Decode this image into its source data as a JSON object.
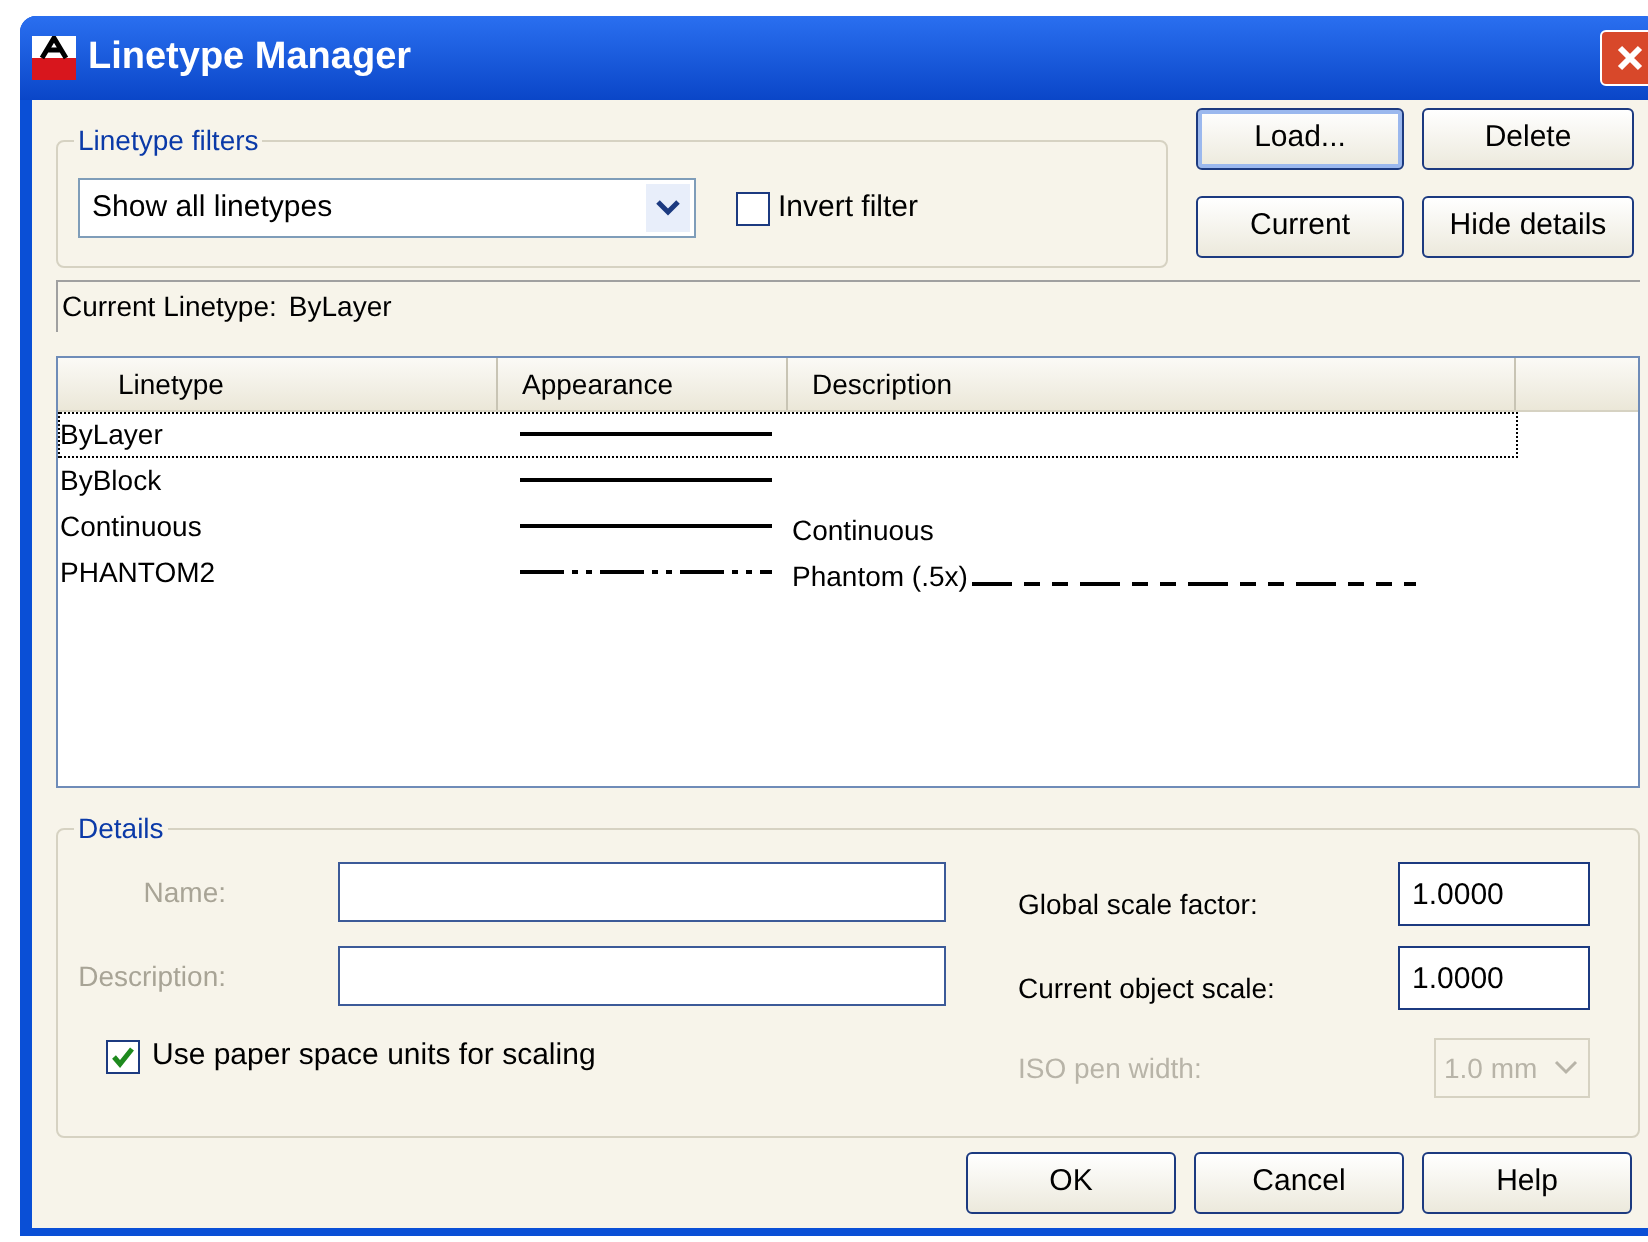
{
  "window": {
    "title": "Linetype Manager"
  },
  "filters": {
    "group_label": "Linetype filters",
    "dropdown": {
      "value": "Show all linetypes"
    },
    "invert_filter": {
      "label": "Invert filter",
      "checked": false
    }
  },
  "buttons_top": [
    {
      "label": "Load..."
    },
    {
      "label": "Delete"
    },
    {
      "label": "Current"
    },
    {
      "label": "Hide details"
    }
  ],
  "current_linetype": {
    "label": "Current Linetype:",
    "value": "ByLayer"
  },
  "table": {
    "columns": [
      "Linetype",
      "Appearance",
      "Description"
    ],
    "rows": [
      {
        "linetype": "ByLayer",
        "kind": "solid",
        "selected": true
      },
      {
        "linetype": "ByBlock",
        "kind": "solid",
        "selected": false
      },
      {
        "linetype": "Continuous",
        "kind": "solid",
        "description": "Continuous",
        "selected": false
      },
      {
        "linetype": "PHANTOM2",
        "kind": "phantom",
        "description": "Phantom (.5x)",
        "sample_after_description": true,
        "selected": false
      }
    ]
  },
  "details": {
    "group_label": "Details",
    "fields": [
      {
        "label": "Name:",
        "disabled": true
      },
      {
        "label": "Description:",
        "disabled": true
      }
    ],
    "paper_space": {
      "label": "Use paper space units for scaling",
      "checked": true
    },
    "scales": [
      {
        "label": "Global scale factor:",
        "value": "1.0000",
        "disabled": false
      },
      {
        "label": "Current object scale:",
        "value": "1.0000",
        "disabled": false
      }
    ],
    "iso_pen_width": {
      "label": "ISO pen width:",
      "value": "1.0 mm",
      "disabled": true
    }
  },
  "buttons_bottom": [
    {
      "label": "OK"
    },
    {
      "label": "Cancel"
    },
    {
      "label": "Help"
    }
  ]
}
